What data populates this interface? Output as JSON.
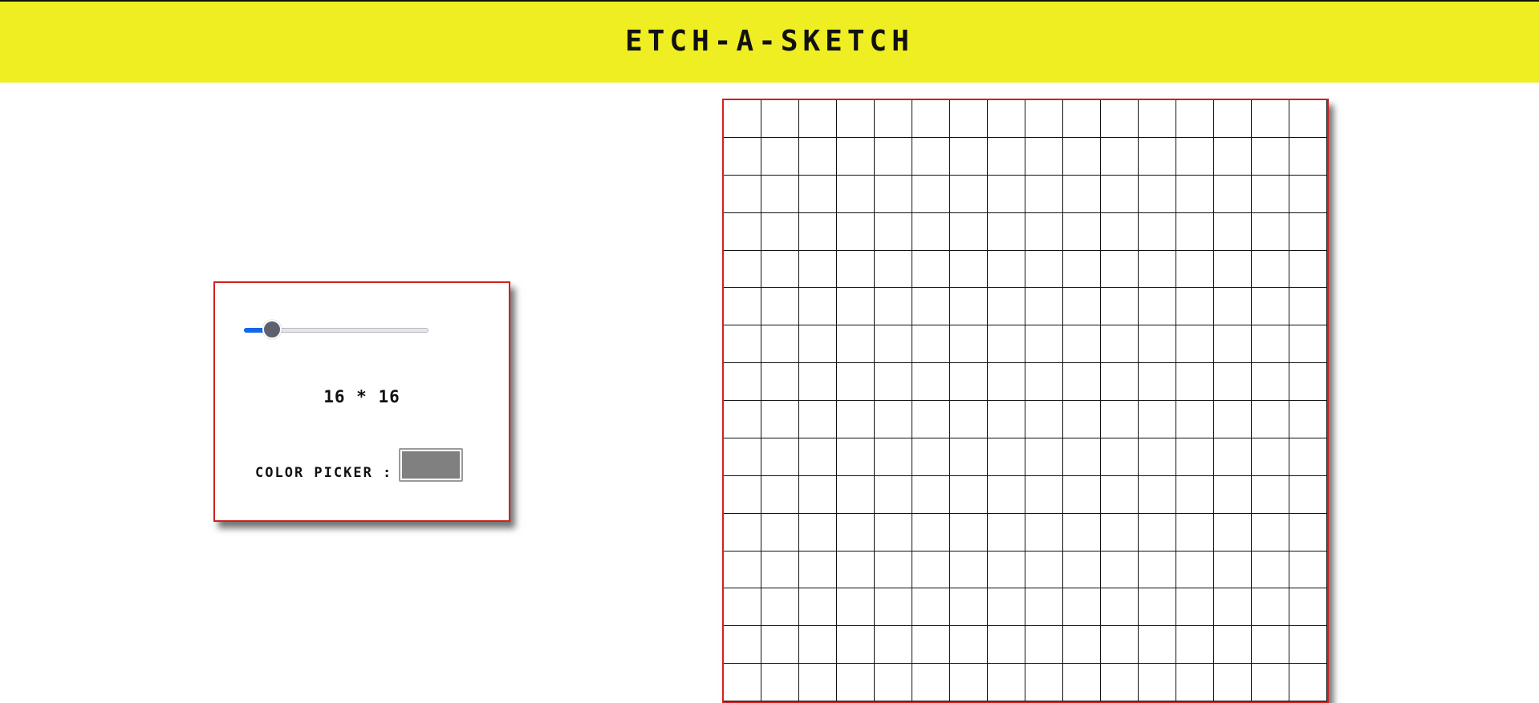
{
  "header": {
    "title": "ETCH-A-SKETCH",
    "background_color": "#eeee22"
  },
  "controls": {
    "slider": {
      "min": 1,
      "max": 100,
      "value": 16
    },
    "size_label": "16 * 16",
    "color_picker": {
      "label": "COLOR PICKER :",
      "value": "#808080"
    },
    "accent_color": "#1467e6",
    "border_color": "#d41f1f"
  },
  "grid": {
    "columns": 16,
    "rows": 16,
    "cell_color": "#ffffff",
    "line_color": "#111111"
  }
}
